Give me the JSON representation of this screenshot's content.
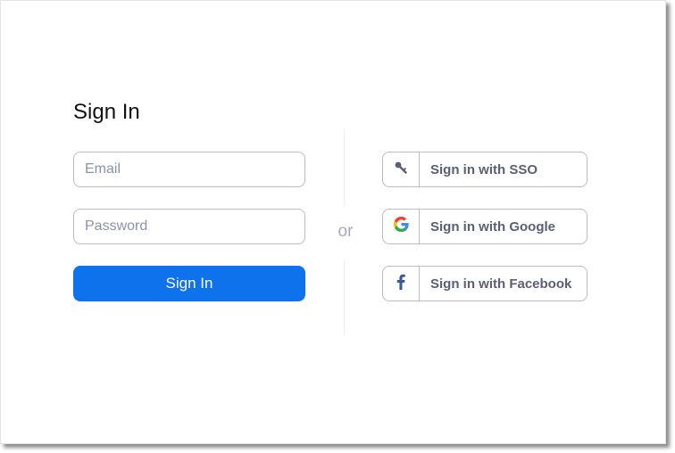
{
  "title": "Sign In",
  "form": {
    "email_placeholder": "Email",
    "password_placeholder": "Password",
    "submit_label": "Sign In"
  },
  "separator": "or",
  "alternatives": {
    "sso_label": "Sign in with SSO",
    "google_label": "Sign in with Google",
    "facebook_label": "Sign in with Facebook"
  },
  "icons": {
    "sso": "key-icon",
    "google": "google-icon",
    "facebook": "facebook-icon"
  },
  "colors": {
    "primary": "#0e72ed",
    "facebook": "#3b5998",
    "google_blue": "#4285f4",
    "google_red": "#ea4335",
    "google_yellow": "#fbbc05",
    "google_green": "#34a853"
  }
}
